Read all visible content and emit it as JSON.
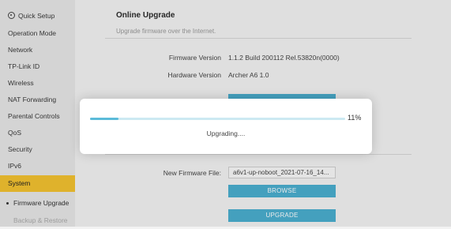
{
  "sidebar": {
    "items": [
      {
        "label": "Quick Setup",
        "icon": "gear-icon"
      },
      {
        "label": "Operation Mode"
      },
      {
        "label": "Network"
      },
      {
        "label": "TP-Link ID"
      },
      {
        "label": "Wireless"
      },
      {
        "label": "NAT Forwarding"
      },
      {
        "label": "Parental Controls"
      },
      {
        "label": "QoS"
      },
      {
        "label": "Security"
      },
      {
        "label": "IPv6"
      },
      {
        "label": "System",
        "active": true
      },
      {
        "label": "Firmware Upgrade"
      },
      {
        "label": "Backup & Restore"
      }
    ],
    "active_color": "#f2c230"
  },
  "main": {
    "title": "Online Upgrade",
    "subtitle": "Upgrade firmware over the Internet.",
    "firmware_version_label": "Firmware Version",
    "firmware_version_value": "1.1.2 Build 200112 Rel.53820n(0000)",
    "hardware_version_label": "Hardware Version",
    "hardware_version_value": "Archer A6 1.0",
    "new_firmware_label": "New Firmware File:",
    "new_firmware_value": "a6v1-up-noboot_2021-07-16_14...",
    "browse_label": "BROWSE",
    "upgrade_label": "UPGRADE",
    "button_color": "#4aaecf"
  },
  "modal": {
    "progress_percent": 11,
    "progress_text": "11%",
    "status_text": "Upgrading...."
  }
}
